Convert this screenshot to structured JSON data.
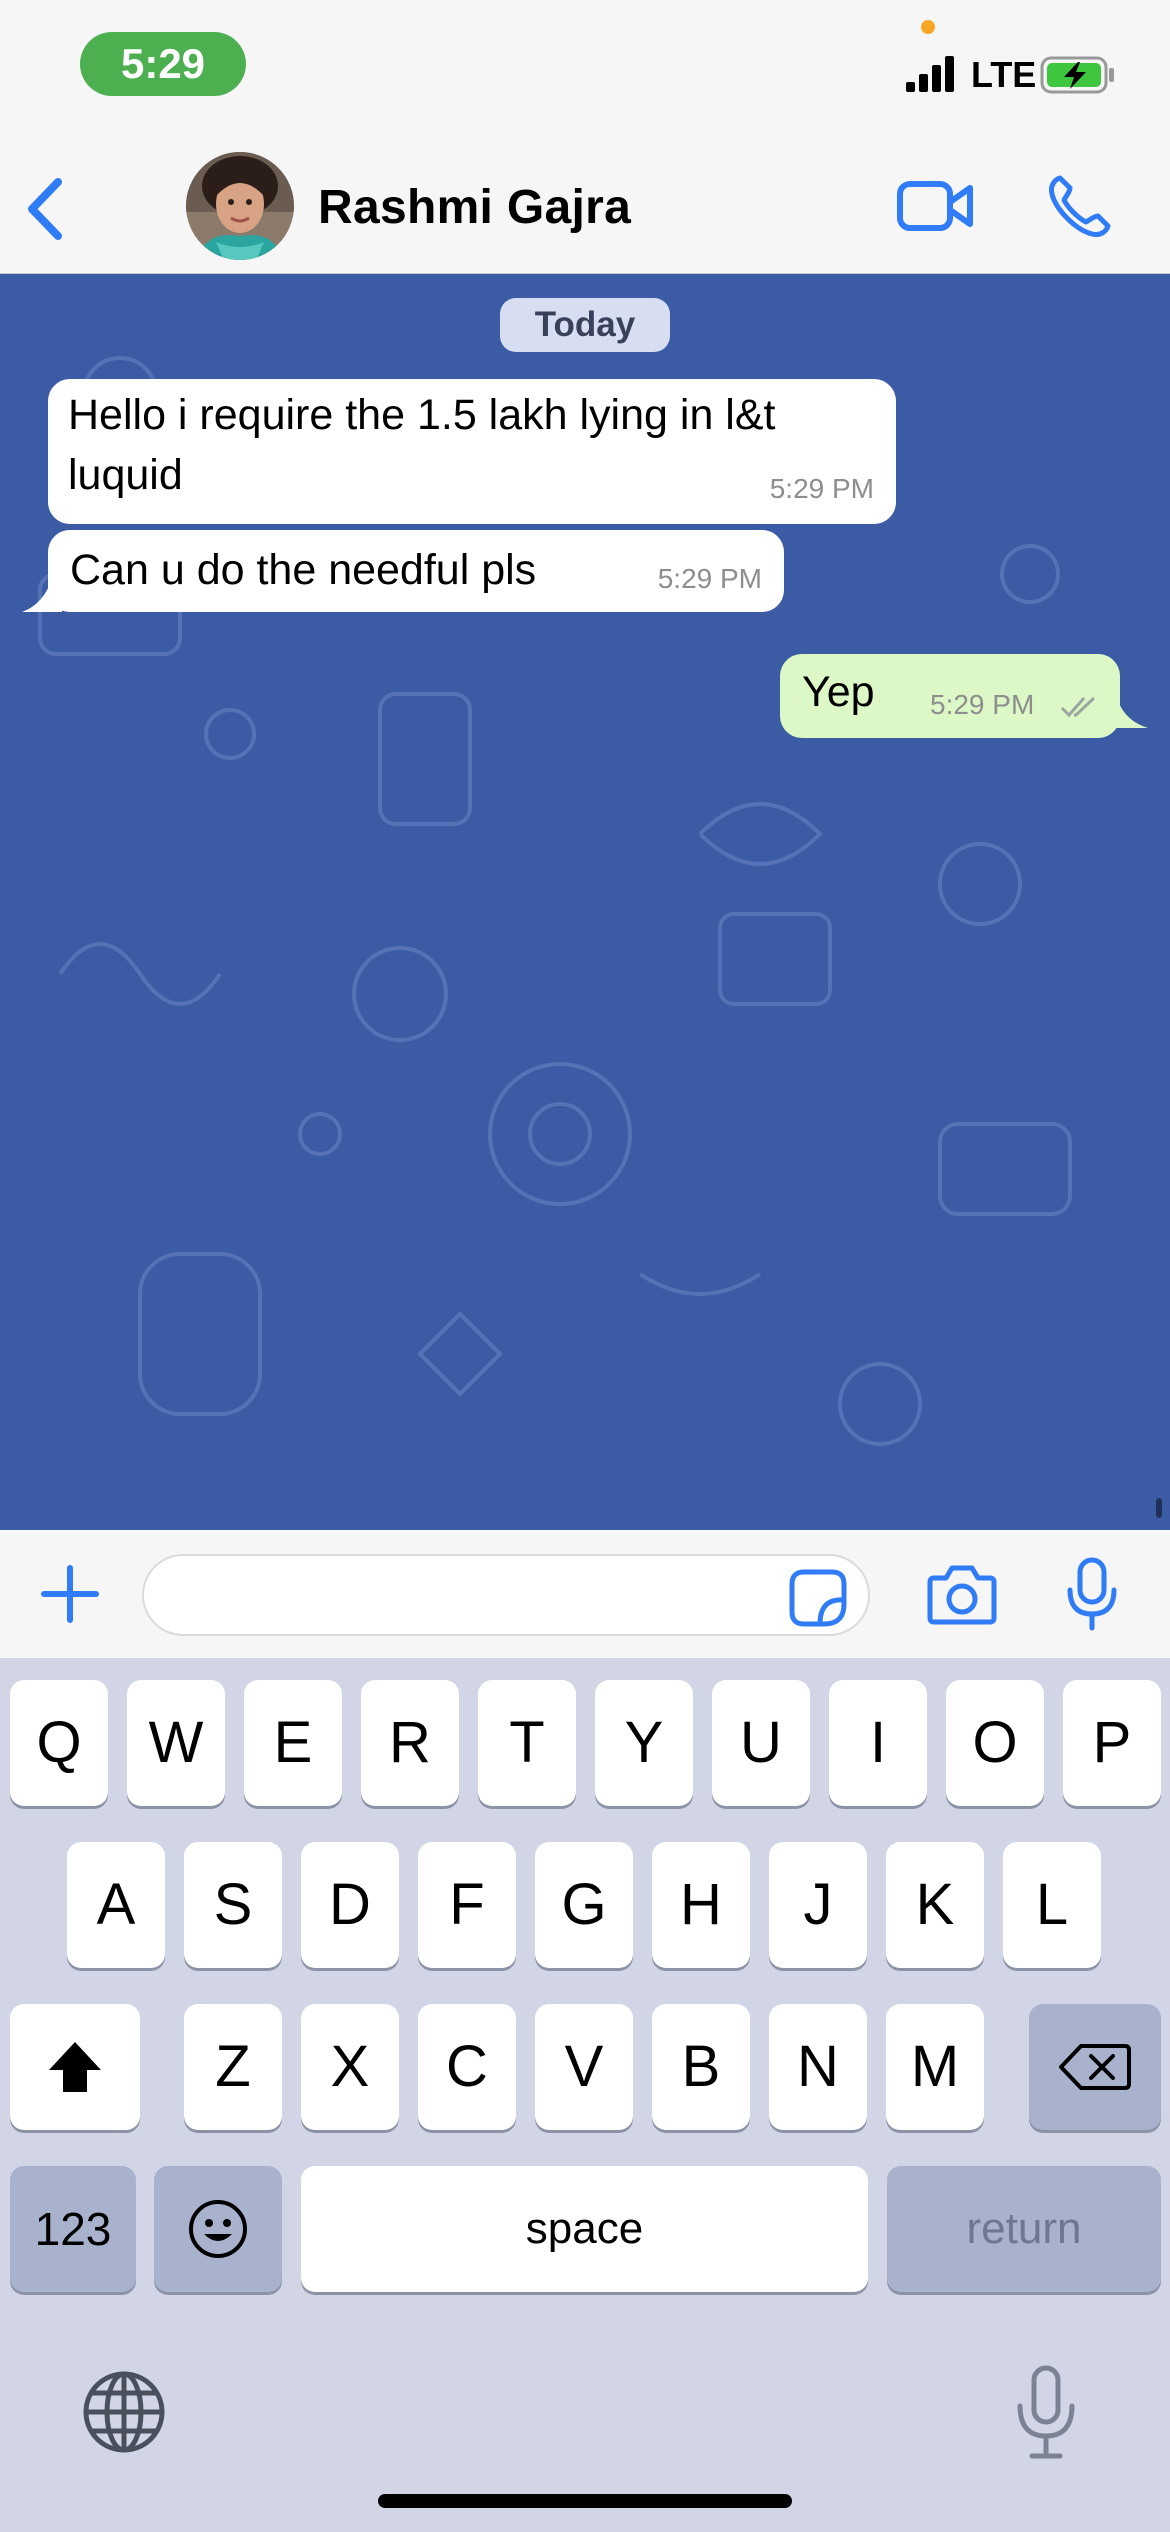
{
  "status_bar": {
    "time": "5:29",
    "network": "LTE"
  },
  "header": {
    "contact_name": "Rashmi Gajra"
  },
  "chat": {
    "date_label": "Today",
    "messages": [
      {
        "direction": "incoming",
        "text": "Hello i require the 1.5 lakh lying in l&t luquid",
        "time": "5:29 PM"
      },
      {
        "direction": "incoming",
        "text": "Can u do the needful pls",
        "time": "5:29 PM"
      },
      {
        "direction": "outgoing",
        "text": "Yep",
        "time": "5:29 PM",
        "status": "read"
      }
    ]
  },
  "input": {
    "value": "",
    "placeholder": ""
  },
  "keyboard": {
    "row1": [
      "Q",
      "W",
      "E",
      "R",
      "T",
      "Y",
      "U",
      "I",
      "O",
      "P"
    ],
    "row2": [
      "A",
      "S",
      "D",
      "F",
      "G",
      "H",
      "J",
      "K",
      "L"
    ],
    "row3": [
      "Z",
      "X",
      "C",
      "V",
      "B",
      "N",
      "M"
    ],
    "numbers_label": "123",
    "space_label": "space",
    "return_label": "return"
  },
  "icons": {
    "back": "chevron-left-icon",
    "video_call": "video-camera-icon",
    "voice_call": "phone-icon",
    "attach": "plus-icon",
    "sticker": "sticker-icon",
    "camera": "camera-icon",
    "voice_note": "microphone-icon",
    "shift": "shift-icon",
    "delete": "backspace-icon",
    "emoji": "emoji-icon",
    "globe": "globe-icon",
    "dictation": "microphone-icon"
  },
  "colors": {
    "accent": "#2f7cf6",
    "chat_background": "#3b5ba5",
    "incoming_bubble": "#ffffff",
    "outgoing_bubble": "#dcf8c6",
    "time_pill": "#4caf50",
    "keyboard_background": "#d1d5e6"
  }
}
